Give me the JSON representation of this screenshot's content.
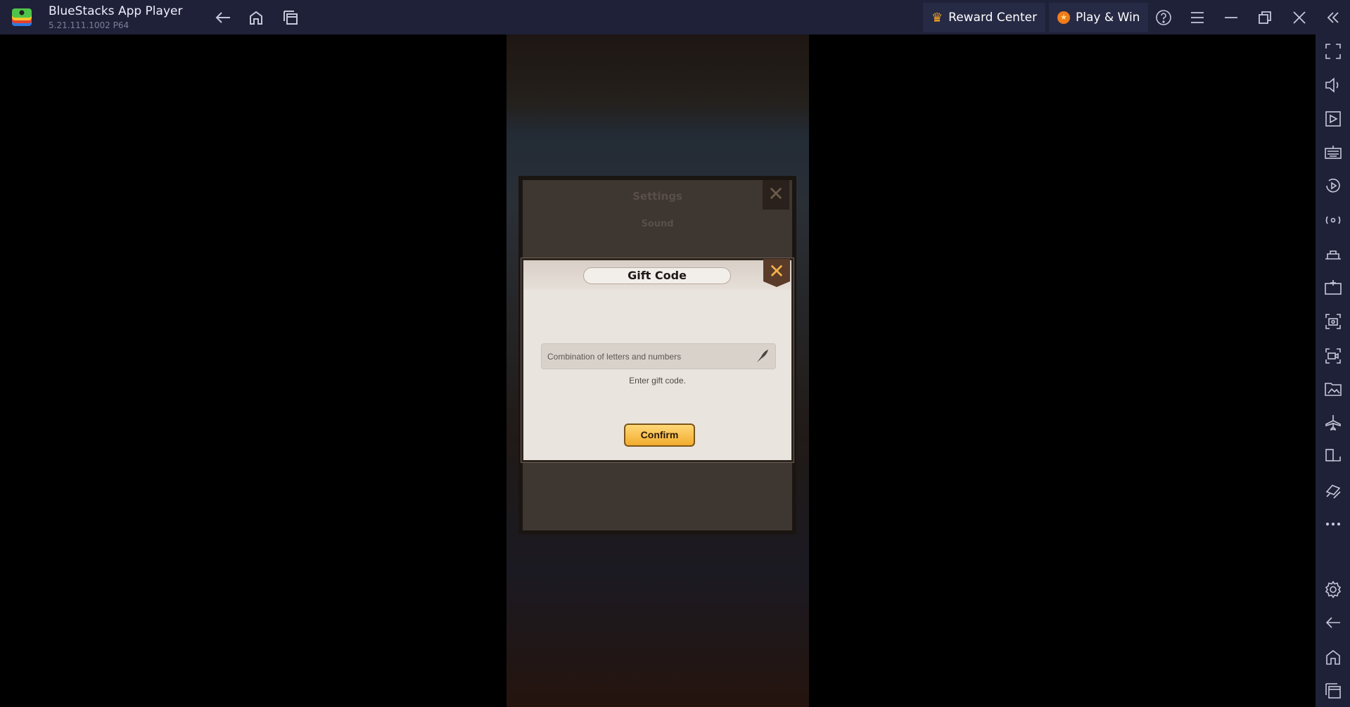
{
  "window": {
    "title": "BlueStacks App Player",
    "version": "5.21.111.1002  P64"
  },
  "toolbar": {
    "reward_center": "Reward Center",
    "play_win": "Play & Win"
  },
  "game": {
    "settings_title": "Settings",
    "settings_sub": "Sound",
    "gift_dialog": {
      "title": "Gift Code",
      "input_placeholder": "Combination of letters and numbers",
      "input_value": "",
      "hint": "Enter gift code.",
      "confirm_label": "Confirm"
    }
  },
  "colors": {
    "chrome": "#1f2138",
    "accent_button": "#f2ac2e"
  },
  "sidebar_icons": [
    "fullscreen-icon",
    "volume-icon",
    "media-icon",
    "keyboard-icon",
    "macro-icon",
    "rotate-sync-icon",
    "apk-station-icon",
    "install-apk-icon",
    "screenshot-icon",
    "record-icon",
    "media-folder-icon",
    "airplane-icon",
    "resize-icon",
    "eco-mode-icon",
    "more-icon",
    "settings-icon",
    "back-icon",
    "home-icon",
    "recent-apps-icon"
  ]
}
